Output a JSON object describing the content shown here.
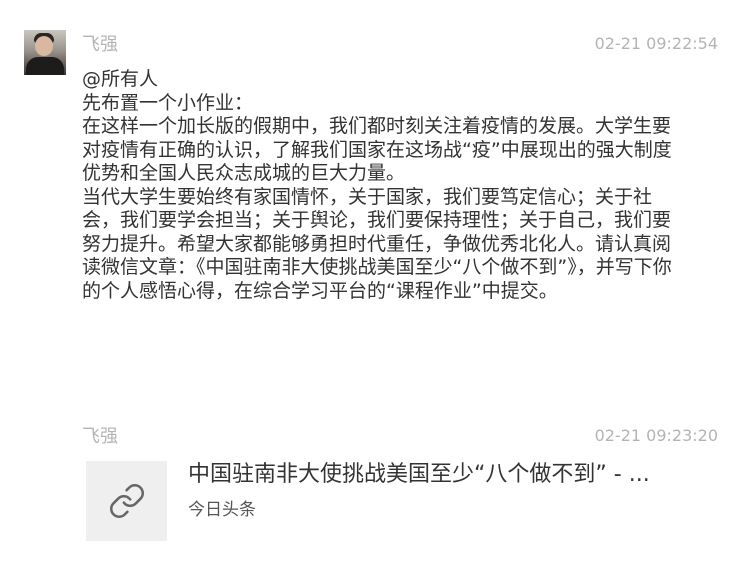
{
  "messages": [
    {
      "sender": "飞强",
      "time": "02-21 09:22:54",
      "text": "@所有人\n先布置一个小作业：\n在这样一个加长版的假期中，我们都时刻关注着疫情的发展。大学生要对疫情有正确的认识，了解我们国家在这场战“疫”中展现出的强大制度优势和全国人民众志成城的巨大力量。\n当代大学生要始终有家国情怀，关于国家，我们要笃定信心；关于社会，我们要学会担当；关于舆论，我们要保持理性；关于自己，我们要努力提升。希望大家都能够勇担时代重任，争做优秀北化人。请认真阅读微信文章：《中国驻南非大使挑战美国至少“八个做不到”》，并写下你的个人感悟心得，在综合学习平台的“课程作业”中提交。"
    },
    {
      "sender": "飞强",
      "time": "02-21 09:23:20",
      "card": {
        "title": "中国驻南非大使挑战美国至少“八个做不到” - ...",
        "source": "今日头条",
        "icon": "link-icon"
      }
    }
  ]
}
